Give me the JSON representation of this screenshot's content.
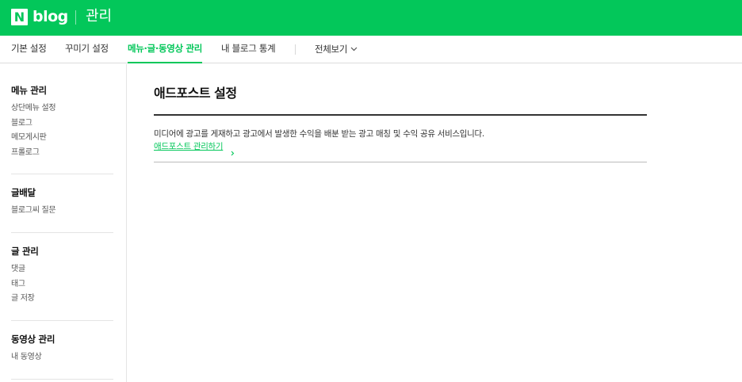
{
  "header": {
    "logo_n": "N",
    "logo_blog": "blog",
    "title": "관리",
    "bg_color": "#03c75a"
  },
  "tabs": [
    {
      "label": "기본 설정",
      "active": false
    },
    {
      "label": "꾸미기 설정",
      "active": false
    },
    {
      "label": "메뉴·글·동영상 관리",
      "active": true
    },
    {
      "label": "내 블로그 통계",
      "active": false
    },
    {
      "label": "전체보기",
      "active": false,
      "icon": "chevron-down-icon"
    }
  ],
  "sidebar": {
    "sections": [
      {
        "title": "메뉴 관리",
        "items": [
          "상단메뉴 설정",
          "블로그",
          "메모게시판",
          "프롤로그"
        ]
      },
      {
        "title": "글배달",
        "items": [
          "블로그씨 질문"
        ]
      },
      {
        "title": "글 관리",
        "items": [
          "댓글",
          "태그",
          "글 저장"
        ]
      },
      {
        "title": "동영상 관리",
        "items": [
          "내 동영상"
        ]
      }
    ]
  },
  "main": {
    "title": "애드포스트 설정",
    "description": "미디어에 광고를 게재하고 광고에서 발생한 수익을 배분 받는 광고 매칭 및 수익 공유 서비스입니다.",
    "link_label": "애드포스트 관리하기",
    "link_icon": "chevron-right-icon"
  },
  "colors": {
    "accent": "#03c75a",
    "text": "#333333"
  }
}
